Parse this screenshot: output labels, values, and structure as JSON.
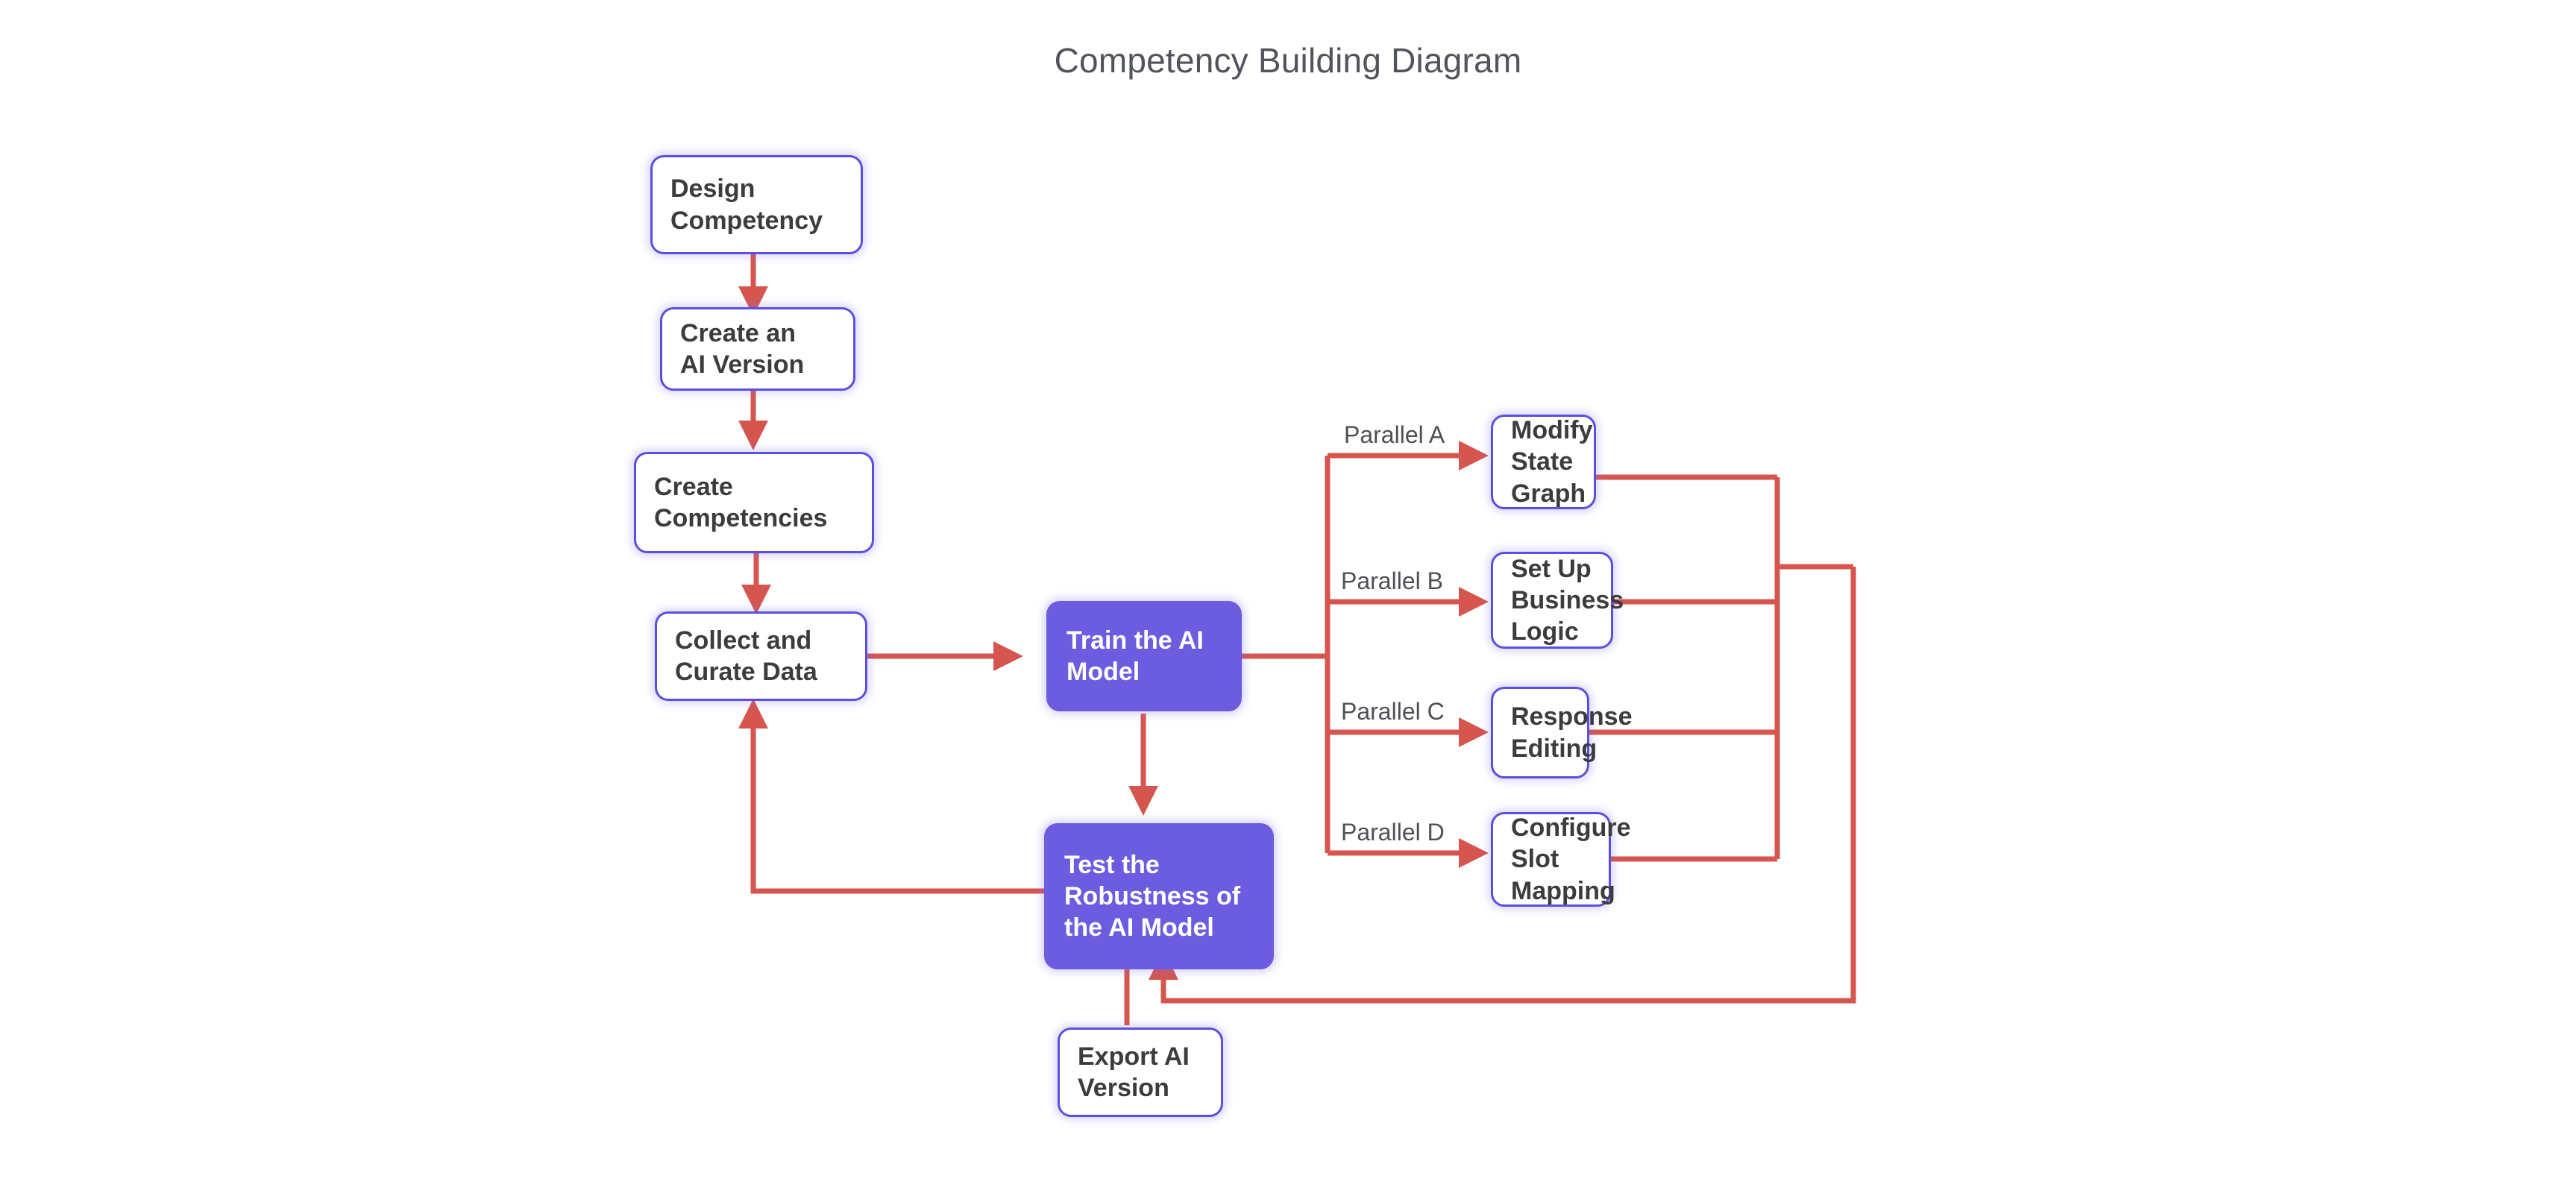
{
  "title": "Competency Building Diagram",
  "theme": {
    "background": "#ffffff",
    "node_border": "#5b4fe0",
    "node_fill_plain": "#ffffff",
    "node_fill_accent": "#6c5ce0",
    "node_text_plain": "#3c3c3c",
    "node_text_accent": "#ffffff",
    "connector": "#d6564f",
    "title_color": "#51545a",
    "edge_label_color": "#4e5056"
  },
  "nodes": {
    "design_competency": {
      "label": "Design\nCompetency",
      "style": "plain"
    },
    "create_an_ai_version": {
      "label": "Create  an\nAI Version",
      "style": "plain"
    },
    "create_competencies": {
      "label": "Create\nCompetencies",
      "style": "plain"
    },
    "collect_and_curate_data": {
      "label": "Collect and\nCurate Data",
      "style": "plain"
    },
    "train_the_ai_model": {
      "label": "Train the AI\nModel",
      "style": "accent"
    },
    "test_the_robustness": {
      "label": "Test the\nRobustness of\nthe AI Model",
      "style": "accent"
    },
    "export_ai_version": {
      "label": "Export AI\nVersion",
      "style": "plain"
    },
    "modify_state_graph": {
      "label": "Modify\nState Graph",
      "style": "plain"
    },
    "set_up_business_logic": {
      "label": "Set Up\nBusiness Logic",
      "style": "plain"
    },
    "response_editing": {
      "label": "Response\nEditing",
      "style": "plain"
    },
    "configure_slot_mapping": {
      "label": "Configure Slot\nMapping",
      "style": "plain"
    }
  },
  "edge_labels": {
    "parallel_a": "Parallel A",
    "parallel_b": "Parallel B",
    "parallel_c": "Parallel C",
    "parallel_d": "Parallel D"
  },
  "edges": [
    {
      "from": "design_competency",
      "to": "create_an_ai_version",
      "label": ""
    },
    {
      "from": "create_an_ai_version",
      "to": "create_competencies",
      "label": ""
    },
    {
      "from": "create_competencies",
      "to": "collect_and_curate_data",
      "label": ""
    },
    {
      "from": "collect_and_curate_data",
      "to": "train_the_ai_model",
      "label": ""
    },
    {
      "from": "train_the_ai_model",
      "to": "test_the_robustness",
      "label": ""
    },
    {
      "from": "train_the_ai_model",
      "to": "modify_state_graph",
      "label": "Parallel A"
    },
    {
      "from": "train_the_ai_model",
      "to": "set_up_business_logic",
      "label": "Parallel B"
    },
    {
      "from": "train_the_ai_model",
      "to": "response_editing",
      "label": "Parallel C"
    },
    {
      "from": "train_the_ai_model",
      "to": "configure_slot_mapping",
      "label": "Parallel D"
    },
    {
      "from": "modify_state_graph",
      "to": "test_the_robustness",
      "label": ""
    },
    {
      "from": "set_up_business_logic",
      "to": "test_the_robustness",
      "label": ""
    },
    {
      "from": "response_editing",
      "to": "test_the_robustness",
      "label": ""
    },
    {
      "from": "configure_slot_mapping",
      "to": "test_the_robustness",
      "label": ""
    },
    {
      "from": "test_the_robustness",
      "to": "collect_and_curate_data",
      "label": ""
    },
    {
      "from": "export_ai_version",
      "to": "test_the_robustness",
      "label": ""
    }
  ]
}
